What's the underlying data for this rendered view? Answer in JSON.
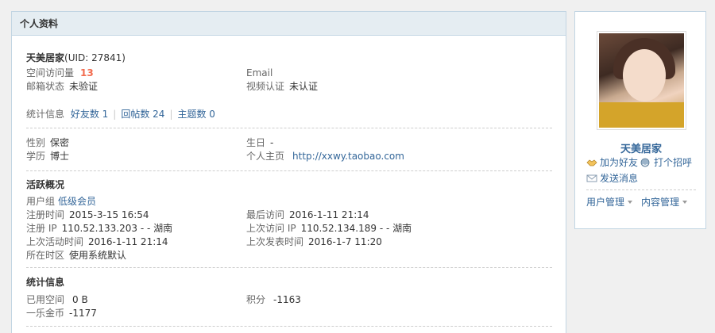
{
  "panel": {
    "title": "个人资料"
  },
  "profile": {
    "name": "天美居家",
    "uid": "(UID: 27841)",
    "visits_label": "空间访问量",
    "visits_value": "13",
    "email_label": "Email",
    "email_status_label": "邮箱状态",
    "email_status_value": "未验证",
    "video_label": "视频认证",
    "video_value": "未认证"
  },
  "stats_line": {
    "label": "统计信息",
    "friends": "好友数 1",
    "replies": "回帖数 24",
    "threads": "主题数 0"
  },
  "basic": {
    "gender_label": "性别",
    "gender_value": "保密",
    "birthday_label": "生日",
    "birthday_value": "-",
    "education_label": "学历",
    "education_value": "博士",
    "homepage_label": "个人主页",
    "homepage_value": "http://xxwy.taobao.com"
  },
  "activity": {
    "title": "活跃概况",
    "group_label": "用户组",
    "group_value": "低级会员",
    "reg_time_label": "注册时间",
    "reg_time_value": "2015-3-15 16:54",
    "last_visit_label": "最后访问",
    "last_visit_value": "2016-1-11 21:14",
    "reg_ip_label": "注册 IP",
    "reg_ip_value": "110.52.133.203 - - 湖南",
    "last_ip_label": "上次访问 IP",
    "last_ip_value": "110.52.134.189 - - 湖南",
    "last_active_label": "上次活动时间",
    "last_active_value": "2016-1-11 21:14",
    "last_post_label": "上次发表时间",
    "last_post_value": "2016-1-7 11:20",
    "timezone_label": "所在时区",
    "timezone_value": "使用系统默认"
  },
  "stats": {
    "title": "统计信息",
    "space_label": "已用空间",
    "space_value": "0 B",
    "points_label": "积分",
    "points_value": "-1163",
    "coins_label": "一乐金币",
    "coins_value": "-1177"
  },
  "sidebar": {
    "name": "天美居家",
    "add_friend": "加为好友",
    "greet": "打个招呼",
    "message": "发送消息",
    "user_manage": "用户管理",
    "content_manage": "内容管理"
  },
  "icons": [
    "handshake-icon",
    "greet-icon",
    "envelope-icon",
    "caret-down-icon"
  ],
  "colors": {
    "link": "#336699",
    "accent": "#f26c4f",
    "header_bg": "#e5edf2",
    "border": "#c2d5e3"
  }
}
